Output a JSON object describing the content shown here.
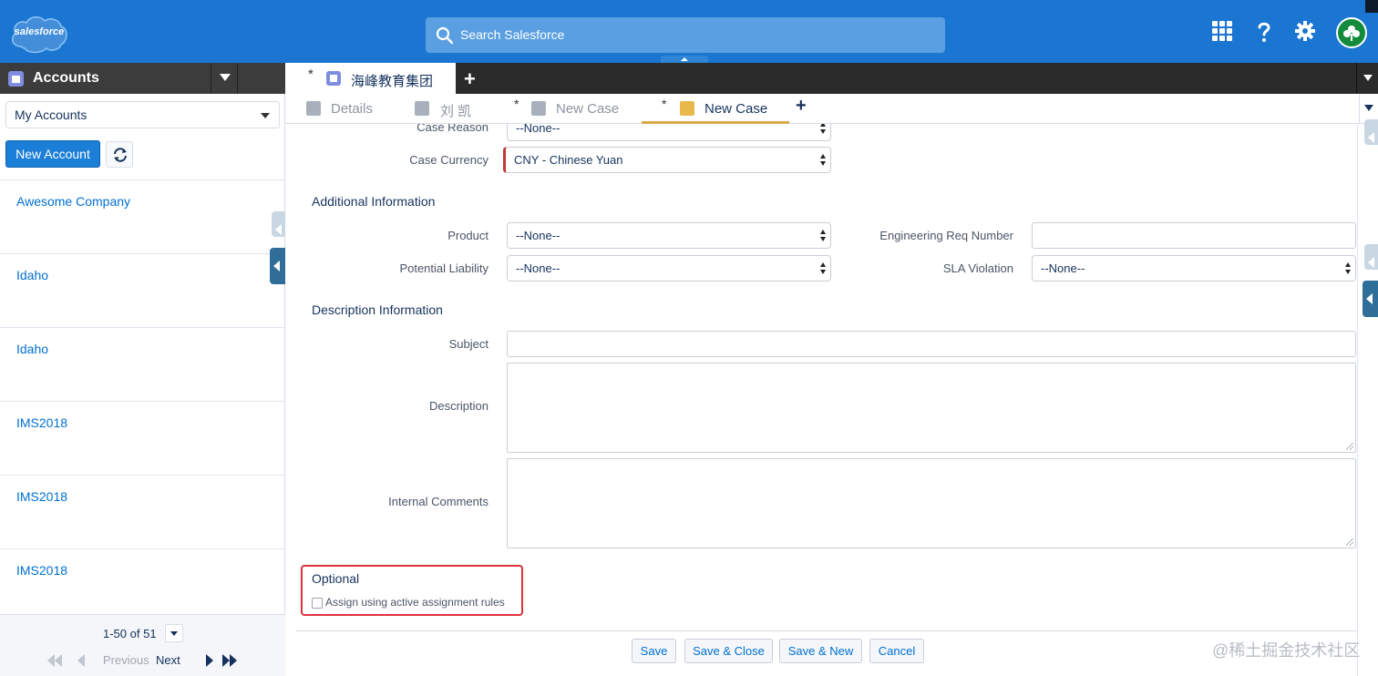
{
  "header": {
    "logo_text": "salesforce",
    "search_placeholder": "Search Salesforce",
    "icons": [
      "search-icon",
      "apps-grid-icon",
      "help-icon",
      "gear-icon",
      "avatar"
    ]
  },
  "left_panel": {
    "title": "Accounts",
    "list_view": "My Accounts",
    "new_button": "New Account",
    "accounts": [
      {
        "name": "Awesome Company"
      },
      {
        "name": "Idaho"
      },
      {
        "name": "Idaho"
      },
      {
        "name": "IMS2018"
      },
      {
        "name": "IMS2018"
      },
      {
        "name": "IMS2018"
      }
    ],
    "pagination": {
      "range": "1-50 of 51",
      "previous": "Previous",
      "next": "Next"
    }
  },
  "primary_tabs": [
    {
      "label": "海峰教育集团",
      "dirty": "*",
      "active": true
    }
  ],
  "subtabs": [
    {
      "label": "Details",
      "dirty": ""
    },
    {
      "label": "刘 凯",
      "dirty": ""
    },
    {
      "label": "New Case",
      "dirty": "*"
    },
    {
      "label": "New Case",
      "dirty": "*",
      "active": true
    }
  ],
  "form": {
    "case_reason": {
      "label": "Case Reason",
      "value": "--None--"
    },
    "case_currency": {
      "label": "Case Currency",
      "value": "CNY - Chinese Yuan"
    },
    "additional_section": "Additional Information",
    "product": {
      "label": "Product",
      "value": "--None--"
    },
    "engineering_req": {
      "label": "Engineering Req Number",
      "value": ""
    },
    "potential_liability": {
      "label": "Potential Liability",
      "value": "--None--"
    },
    "sla_violation": {
      "label": "SLA Violation",
      "value": "--None--"
    },
    "description_section": "Description Information",
    "subject": {
      "label": "Subject",
      "value": ""
    },
    "description": {
      "label": "Description",
      "value": ""
    },
    "internal_comments": {
      "label": "Internal Comments",
      "value": ""
    },
    "optional": {
      "title": "Optional",
      "checkbox_label": "Assign using active assignment rules",
      "checked": false
    },
    "buttons": {
      "save": "Save",
      "save_close": "Save & Close",
      "save_new": "Save & New",
      "cancel": "Cancel"
    }
  },
  "watermark": "@稀土掘金技术社区",
  "colors": {
    "header_bg": "#1b76d1",
    "dark_bar": "#2b2b2b",
    "link": "#0070d2",
    "highlight_border": "#e0323e",
    "active_subtab": "#d8a94a"
  }
}
